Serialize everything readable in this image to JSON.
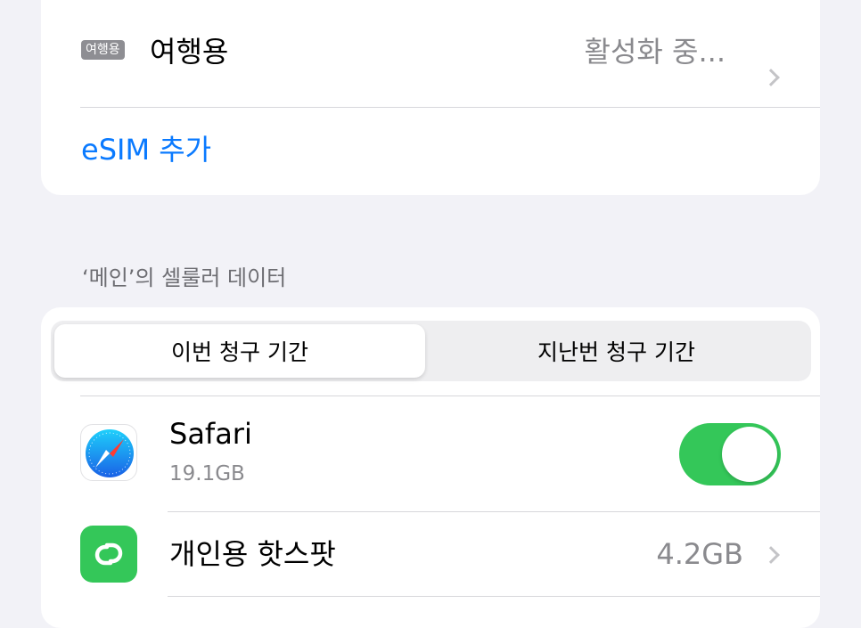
{
  "esim": {
    "line_tag": "여행용",
    "line_name": "여행용",
    "status": "활성화 중...",
    "add_label": "eSIM 추가"
  },
  "cellular": {
    "section_header": "‘메인’의 셀룰러 데이터",
    "segments": [
      {
        "label": "이번 청구 기간",
        "selected": true
      },
      {
        "label": "지난번 청구 기간",
        "selected": false
      }
    ],
    "apps": [
      {
        "name": "Safari",
        "usage": "19.1GB",
        "toggle_on": true,
        "icon": "safari-compass-icon"
      },
      {
        "name": "개인용 핫스팟",
        "usage": "4.2GB",
        "icon": "hotspot-link-icon"
      }
    ]
  },
  "colors": {
    "accent": "#0a7aff",
    "toggle_on": "#34c759",
    "background": "#f2f2f7"
  }
}
